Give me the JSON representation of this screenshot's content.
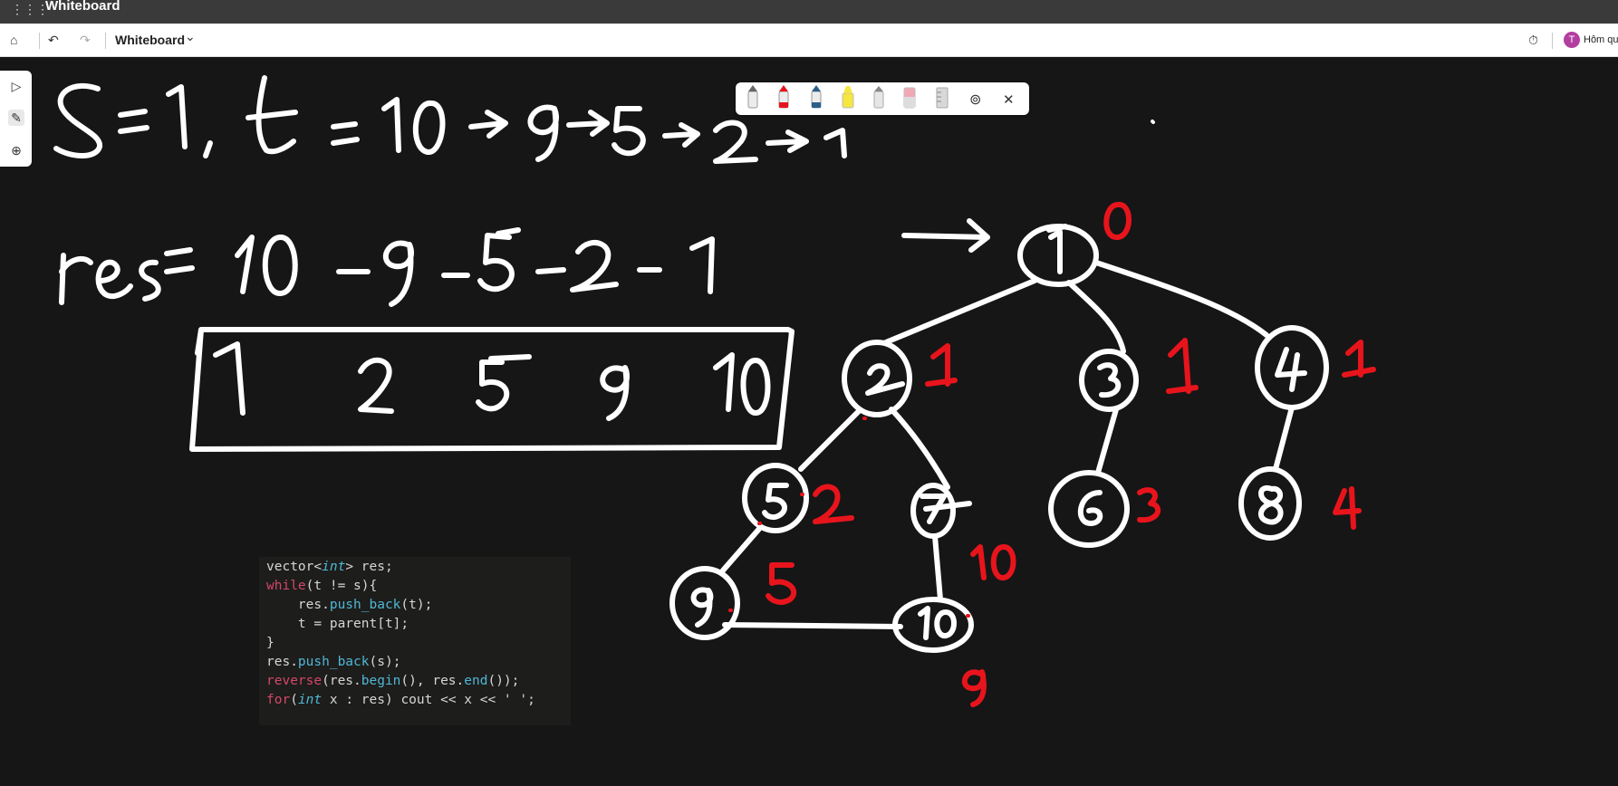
{
  "window": {
    "title": "Whiteboard"
  },
  "toolbar": {
    "board_title": "Whiteboard",
    "user_initial": "T",
    "user_name": "Hôm qu"
  },
  "icons": {
    "apps": "⋮⋮⋮",
    "home": "⌂",
    "undo": "↶",
    "redo": "↷",
    "chevron": "⌄",
    "timer": "⏱",
    "select": "▷",
    "pen": "✎",
    "add": "⊕",
    "lasso": "⊚",
    "close": "✕"
  },
  "ink_colors": {
    "white": "#ffffff",
    "red": "#e8141c"
  },
  "code": {
    "lines": [
      "vector<int> res;",
      "while(t != s){",
      "    res.push_back(t);",
      "    t = parent[t];",
      "}",
      "res.push_back(s);",
      "reverse(res.begin(), res.end());",
      "for(int x : res) cout << x << ' ';"
    ]
  }
}
